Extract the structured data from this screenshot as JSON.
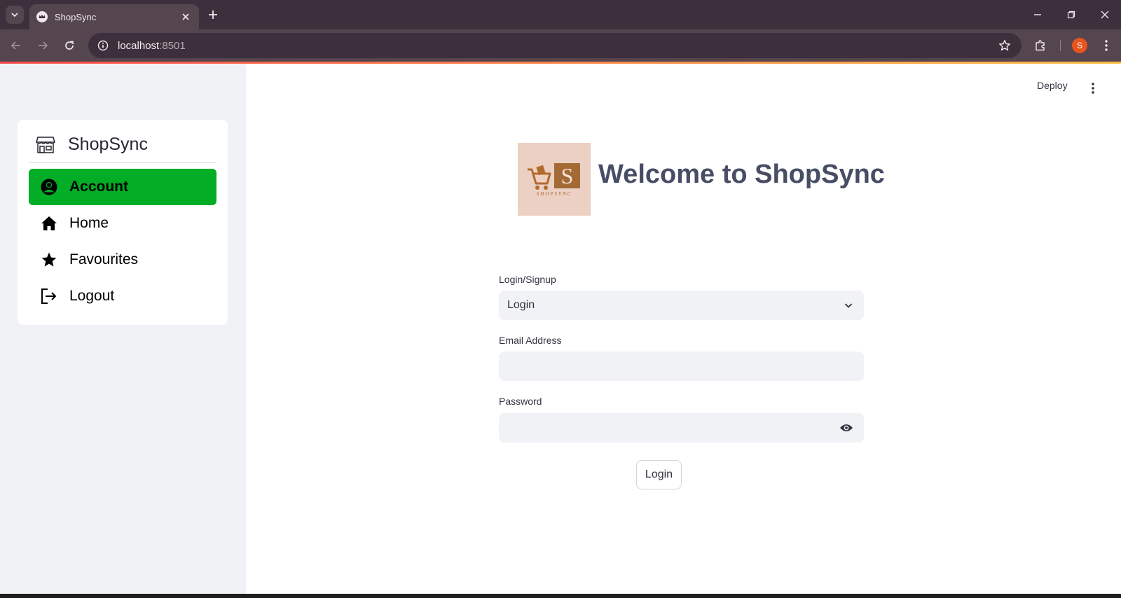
{
  "browser": {
    "tab_title": "ShopSync",
    "url_host": "localhost",
    "url_port": ":8501",
    "profile_initial": "S"
  },
  "header": {
    "deploy_label": "Deploy"
  },
  "sidebar": {
    "title": "ShopSync",
    "items": [
      {
        "label": "Account",
        "icon": "account-circle-icon",
        "active": true
      },
      {
        "label": "Home",
        "icon": "house-icon",
        "active": false
      },
      {
        "label": "Favourites",
        "icon": "star-icon",
        "active": false
      },
      {
        "label": "Logout",
        "icon": "logout-icon",
        "active": false
      }
    ],
    "active_color": "#03ad25"
  },
  "main": {
    "logo_letter": "S",
    "logo_text": "SHOPSYNC",
    "welcome": "Welcome to ShopSync",
    "mode_label": "Login/Signup",
    "mode_value": "Login",
    "email_label": "Email Address",
    "email_value": "",
    "password_label": "Password",
    "password_value": "",
    "submit_label": "Login"
  }
}
